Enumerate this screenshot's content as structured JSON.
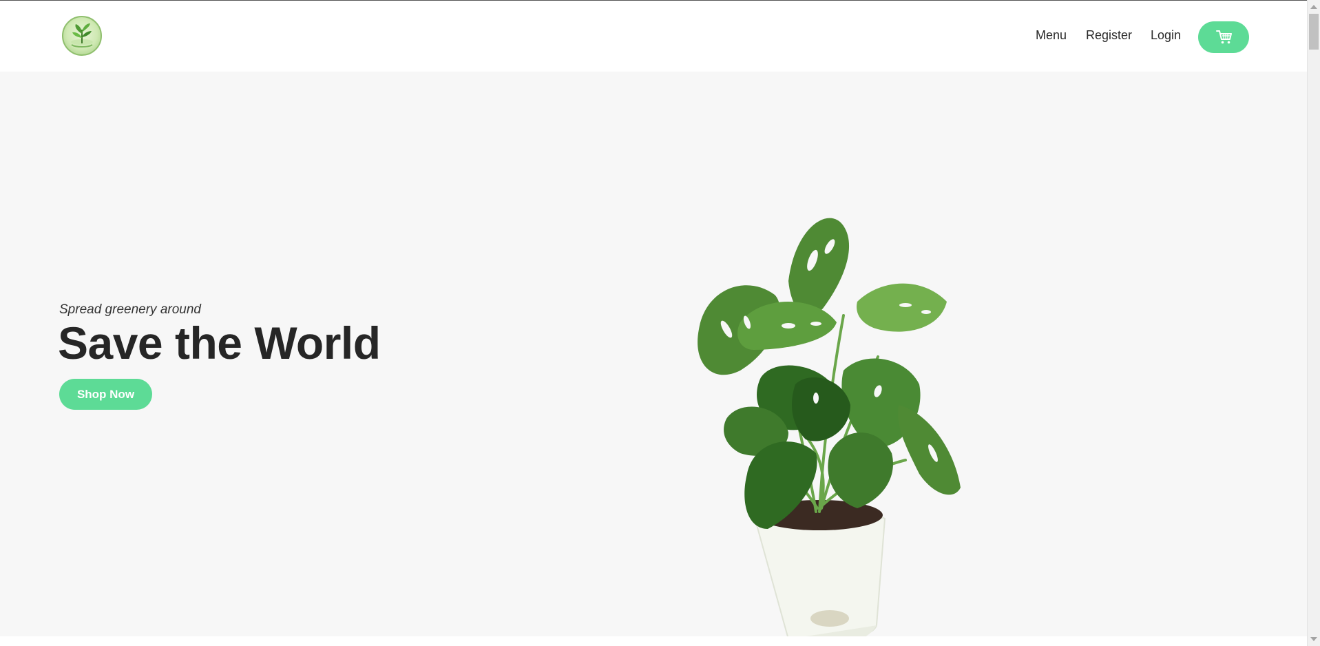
{
  "brand": {
    "logo_icon": "plant-logo-icon"
  },
  "nav": {
    "menu_label": "Menu",
    "register_label": "Register",
    "login_label": "Login",
    "cart_icon": "cart-icon"
  },
  "hero": {
    "tagline": "Spread greenery around",
    "headline": "Save the World",
    "cta_label": "Shop Now",
    "image": "potted-monstera-plant"
  },
  "colors": {
    "accent": "#5ddb96",
    "hero_background": "#f7f7f7",
    "header_background": "#ffffff",
    "text_dark": "#262626"
  }
}
